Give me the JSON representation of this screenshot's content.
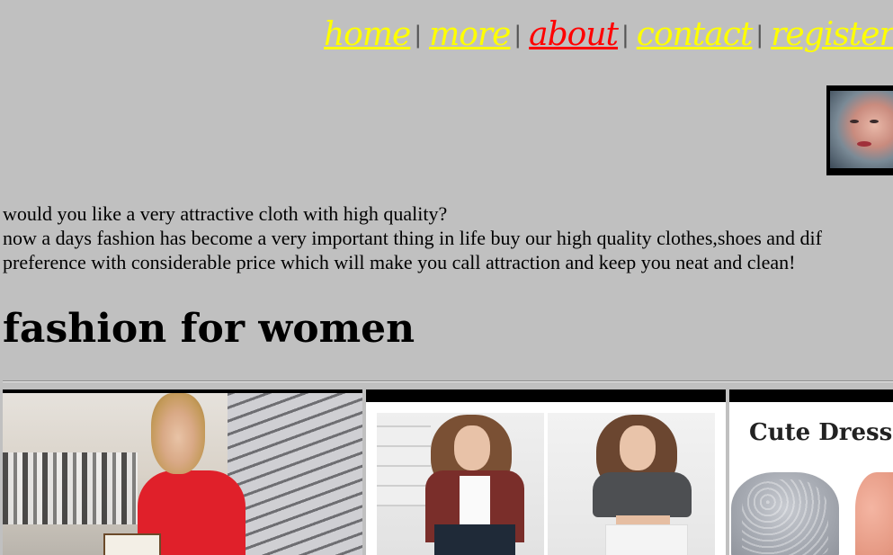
{
  "nav": {
    "items": [
      {
        "label": "home",
        "active": false
      },
      {
        "label": "more",
        "active": false
      },
      {
        "label": "about",
        "active": true
      },
      {
        "label": "contact",
        "active": false
      },
      {
        "label": "register",
        "active": false
      }
    ],
    "separator": "|",
    "link_color": "#ffff00",
    "active_color": "#ff0000"
  },
  "intro": {
    "line1": "would you like a very attractive cloth with high quality?",
    "line2": "now a days fashion has become a very important thing in life buy our high quality clothes,shoes and dif",
    "line3": "preference with considerable price which will make you call attraction and keep you neat and clean!"
  },
  "section": {
    "heading": "fashion for women"
  },
  "gallery": {
    "photo3_caption": "Cute Dress"
  },
  "colors": {
    "background": "#c0c0c0",
    "text": "#000000"
  }
}
